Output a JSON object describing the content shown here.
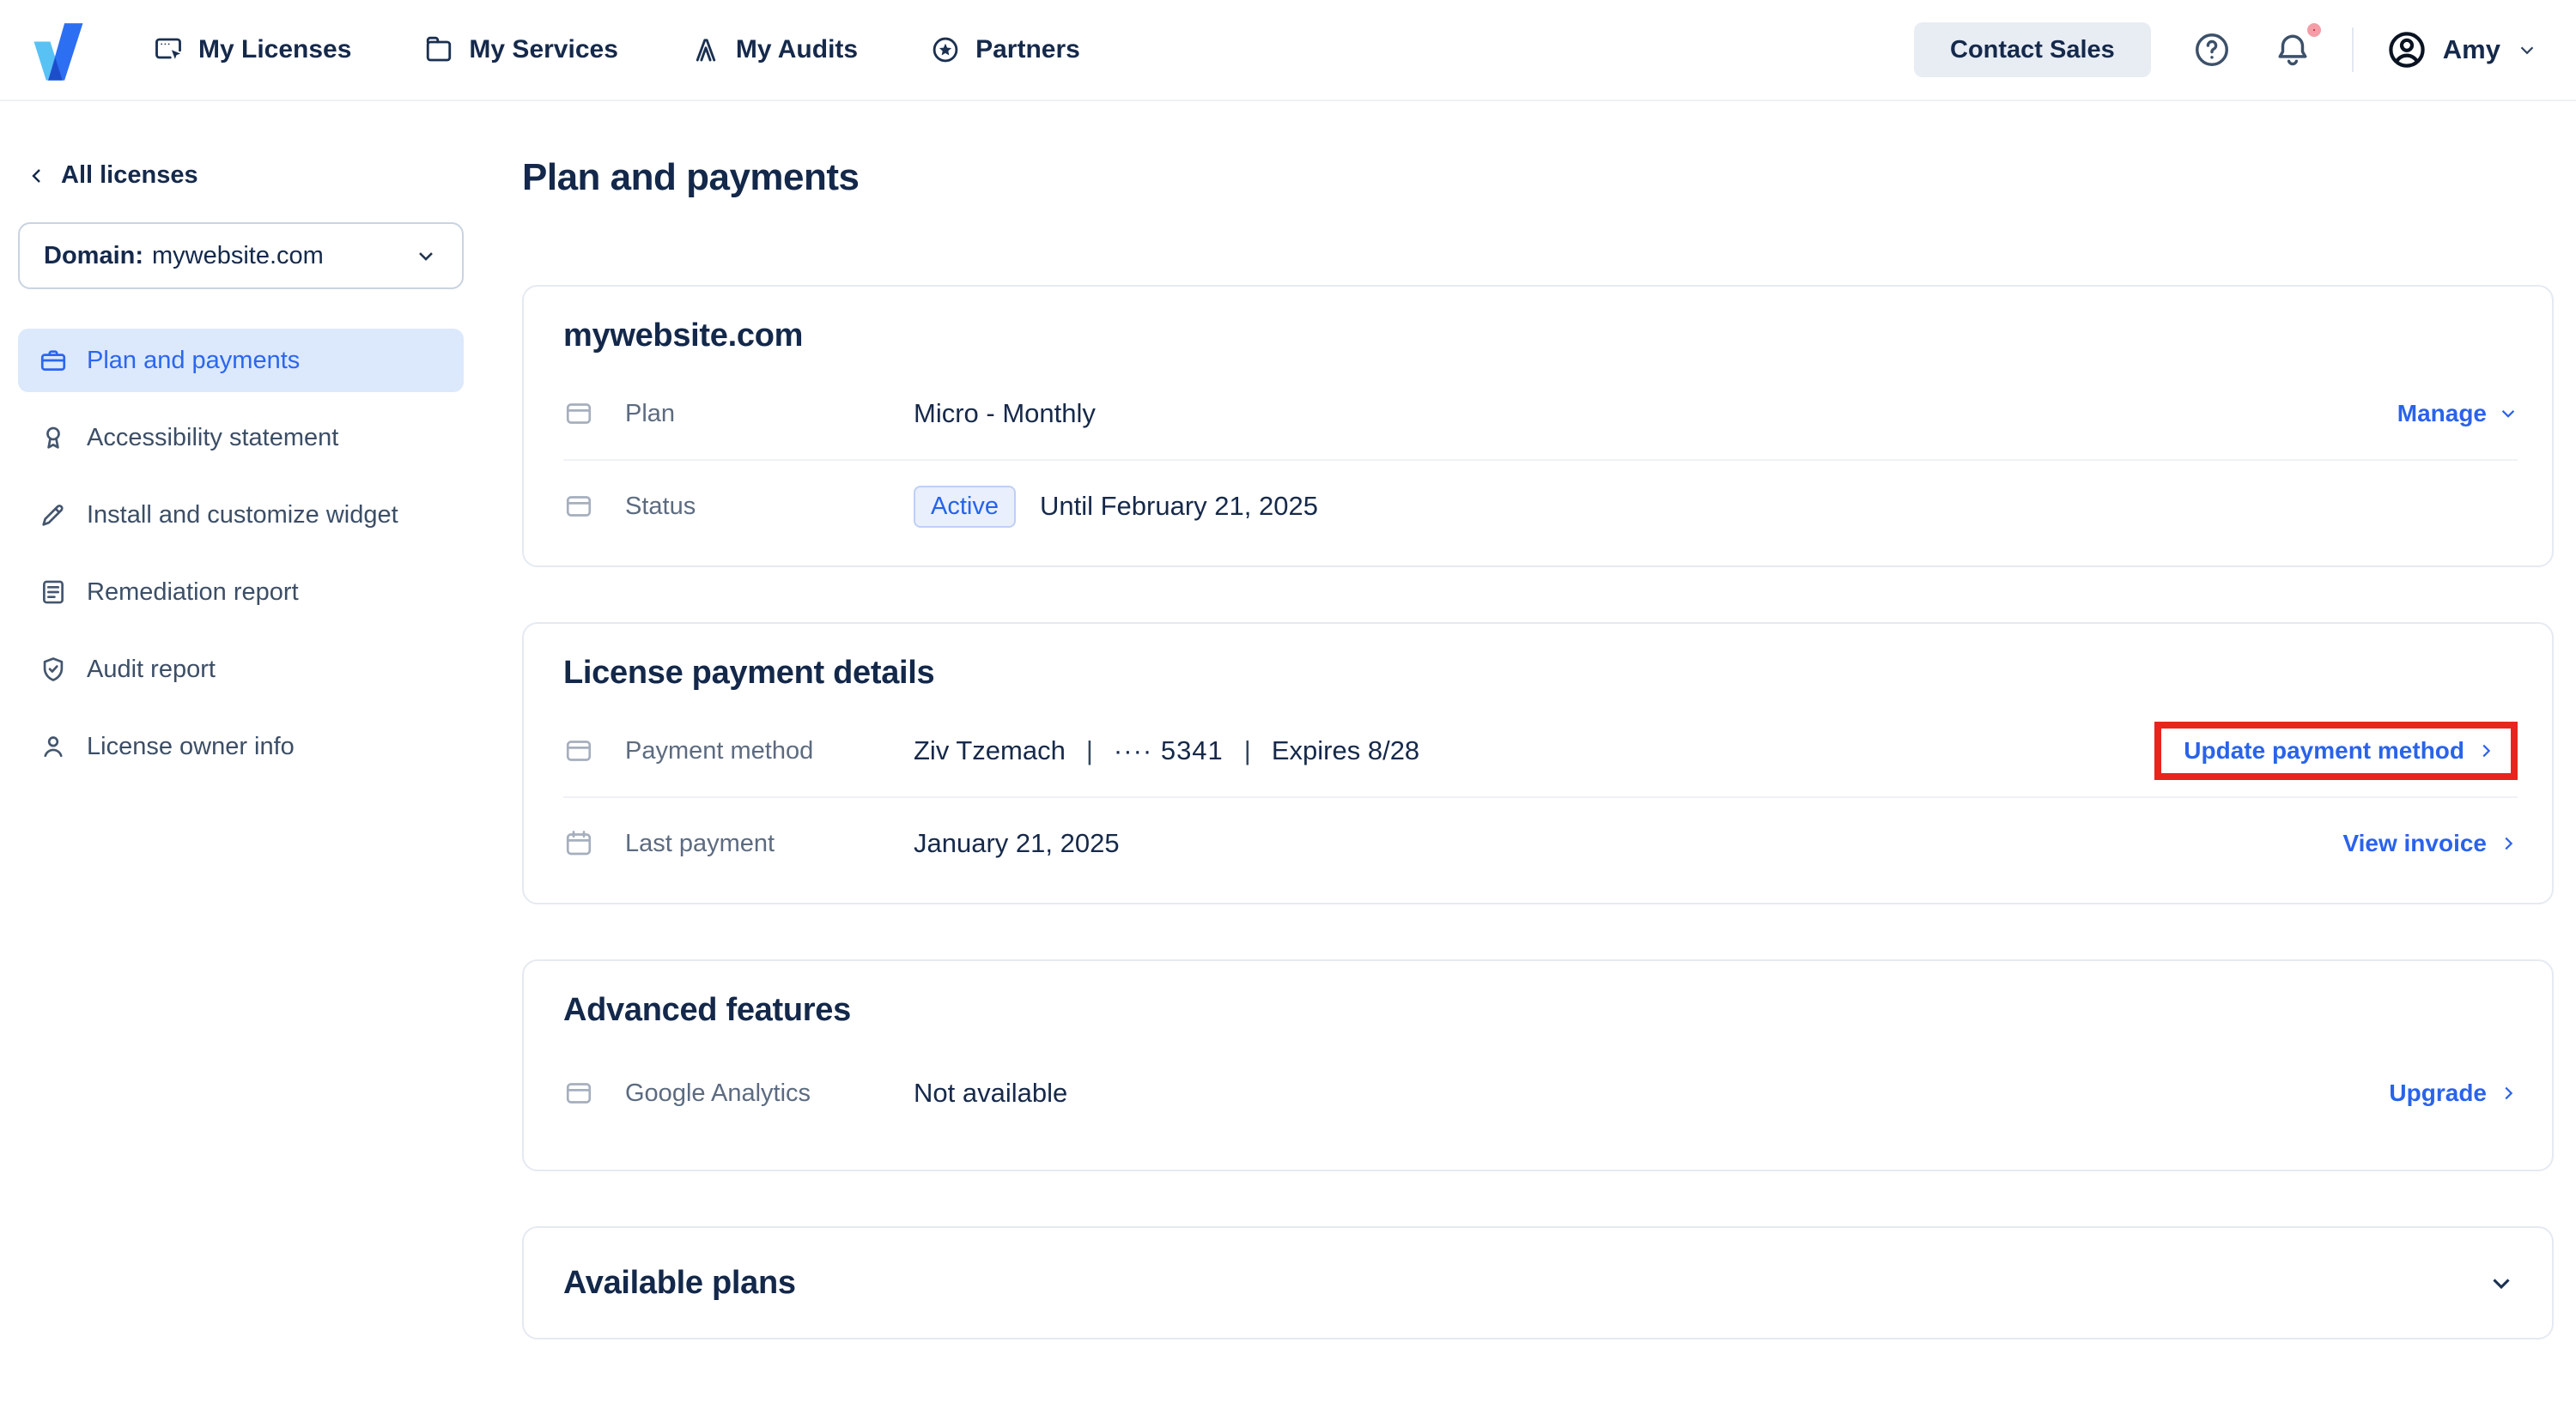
{
  "header": {
    "nav_items": [
      {
        "label": "My Licenses",
        "icon": "licenses-icon"
      },
      {
        "label": "My Services",
        "icon": "services-icon"
      },
      {
        "label": "My Audits",
        "icon": "audits-icon"
      },
      {
        "label": "Partners",
        "icon": "partners-icon"
      }
    ],
    "contact_sales_label": "Contact Sales",
    "help_icon": "question-circle-icon",
    "notification_icon": "bell-icon",
    "notification_dot": true,
    "user_name": "Amy"
  },
  "sidebar": {
    "back_label": "All licenses",
    "domain": {
      "label": "Domain:",
      "value": "mywebsite.com"
    },
    "items": [
      {
        "label": "Plan and payments",
        "icon": "briefcase-icon",
        "active": true
      },
      {
        "label": "Accessibility statement",
        "icon": "award-icon",
        "active": false
      },
      {
        "label": "Install and customize widget",
        "icon": "pencil-icon",
        "active": false
      },
      {
        "label": "Remediation report",
        "icon": "document-icon",
        "active": false
      },
      {
        "label": "Audit report",
        "icon": "shield-check-icon",
        "active": false
      },
      {
        "label": "License owner info",
        "icon": "person-icon",
        "active": false
      }
    ]
  },
  "page": {
    "title": "Plan and payments"
  },
  "cards": {
    "domain": {
      "title": "mywebsite.com",
      "plan": {
        "icon": "credit-card-icon",
        "label": "Plan",
        "value": "Micro - Monthly",
        "action": "Manage"
      },
      "status": {
        "icon": "credit-card-icon",
        "label": "Status",
        "badge": "Active",
        "value": "Until February 21, 2025"
      }
    },
    "payment": {
      "title": "License payment details",
      "method": {
        "icon": "credit-card-icon",
        "label": "Payment method",
        "name": "Ziv Tzemach",
        "digits": "···· 5341",
        "expires": "Expires 8/28",
        "separator": "|",
        "action": "Update payment method",
        "action_highlighted": true
      },
      "last": {
        "icon": "calendar-icon",
        "label": "Last payment",
        "value": "January 21, 2025",
        "action": "View invoice"
      }
    },
    "advanced": {
      "title": "Advanced features",
      "ga": {
        "icon": "credit-card-icon",
        "label": "Google Analytics",
        "value": "Not available",
        "action": "Upgrade"
      }
    },
    "plans": {
      "title": "Available plans",
      "collapsed": true
    }
  },
  "colors": {
    "accent_blue": "#2A63EA",
    "navy_text": "#14294B",
    "sidebar_active_bg": "#DCE8FC",
    "badge_bg": "#E9EFFC",
    "badge_border": "#BED0F7",
    "annotation_red": "#E8251D",
    "notification_red": "#C3161C",
    "card_border": "#E5EAF2",
    "contact_button_bg": "#E8EDF4"
  }
}
